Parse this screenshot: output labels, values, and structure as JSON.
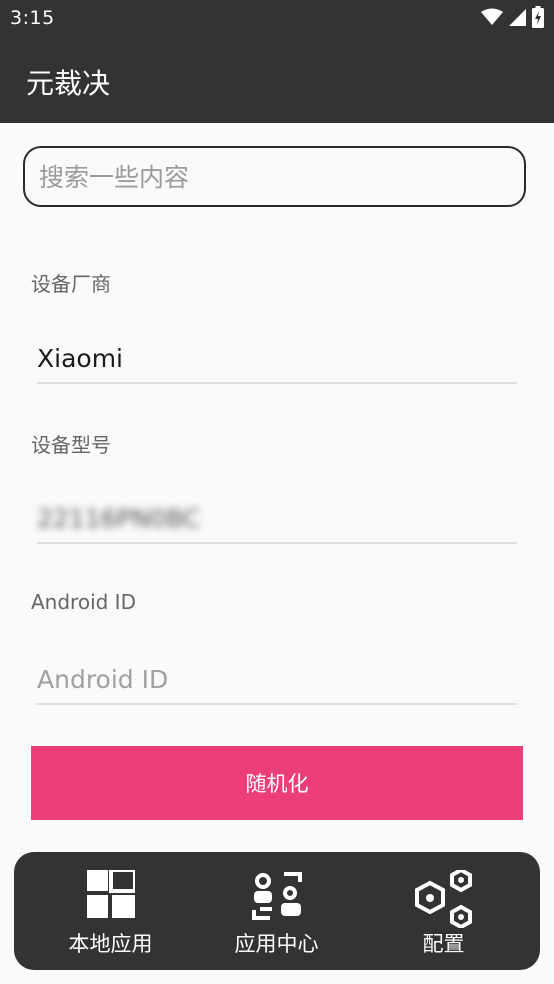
{
  "status_bar": {
    "time": "3:15",
    "icons": [
      "wifi-icon",
      "signal-icon",
      "battery-charging-icon"
    ]
  },
  "app_bar": {
    "title": "元裁决"
  },
  "search": {
    "placeholder": "搜索一些内容",
    "value": ""
  },
  "form": {
    "manufacturer": {
      "label": "设备厂商",
      "value": "Xiaomi"
    },
    "model": {
      "label": "设备型号",
      "value": "22116PN0BC"
    },
    "android_id": {
      "label": "Android ID",
      "value": "",
      "placeholder": "Android ID"
    }
  },
  "randomize_button": {
    "label": "随机化"
  },
  "bottom_nav": {
    "items": [
      {
        "label": "本地应用",
        "icon": "grid-apps-icon"
      },
      {
        "label": "应用中心",
        "icon": "app-center-icon"
      },
      {
        "label": "配置",
        "icon": "hexagon-settings-icon"
      }
    ]
  },
  "colors": {
    "bar_background": "#333333",
    "accent": "#ec3f7a",
    "page_background": "#fafafa"
  }
}
